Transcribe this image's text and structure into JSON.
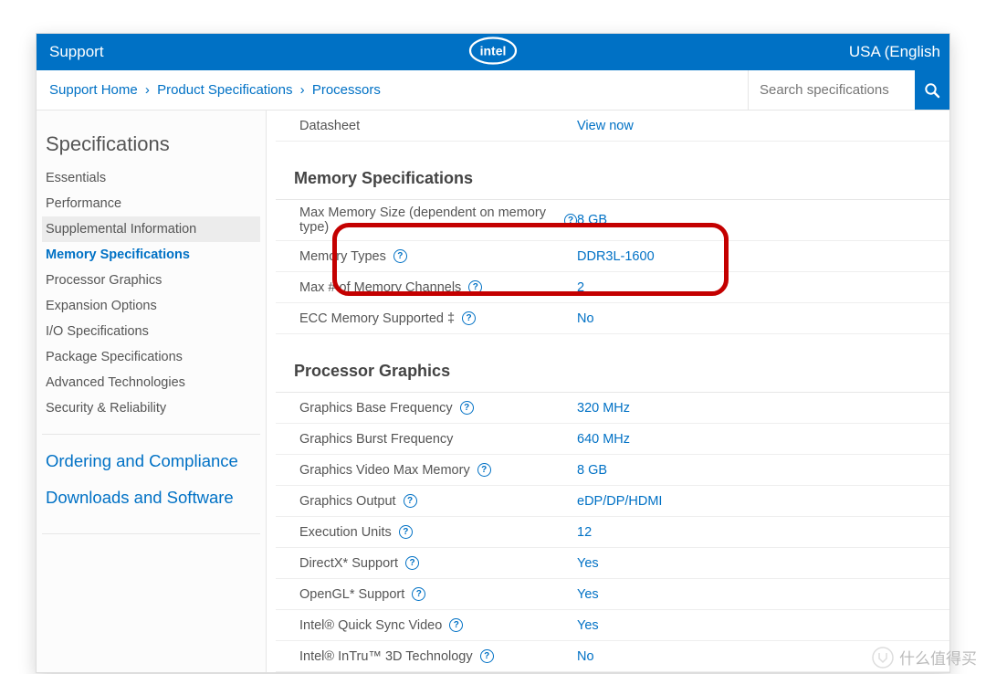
{
  "topbar": {
    "support": "Support",
    "region": "USA (English"
  },
  "breadcrumbs": {
    "a": "Support Home",
    "b": "Product Specifications",
    "c": "Processors",
    "sep": "›"
  },
  "search": {
    "placeholder": "Search specifications"
  },
  "sidebar": {
    "title": "Specifications",
    "items": [
      "Essentials",
      "Performance",
      "Supplemental Information",
      "Memory Specifications",
      "Processor Graphics",
      "Expansion Options",
      "I/O Specifications",
      "Package Specifications",
      "Advanced Technologies",
      "Security & Reliability"
    ],
    "big1": "Ordering and Compliance",
    "big2": "Downloads and Software"
  },
  "prelude": {
    "label": "Datasheet",
    "value": "View now"
  },
  "sections": [
    {
      "title": "Memory Specifications",
      "rows": [
        {
          "label": "Max Memory Size (dependent on memory type)",
          "help": true,
          "value": "8 GB"
        },
        {
          "label": "Memory Types",
          "help": true,
          "value": "DDR3L-1600"
        },
        {
          "label": "Max # of Memory Channels",
          "help": true,
          "value": "2"
        },
        {
          "label": "ECC Memory Supported ‡",
          "help": true,
          "value": "No"
        }
      ]
    },
    {
      "title": "Processor Graphics",
      "rows": [
        {
          "label": "Graphics Base Frequency",
          "help": true,
          "value": "320 MHz"
        },
        {
          "label": "Graphics Burst Frequency",
          "help": false,
          "value": "640 MHz"
        },
        {
          "label": "Graphics Video Max Memory",
          "help": true,
          "value": "8 GB"
        },
        {
          "label": "Graphics Output",
          "help": true,
          "value": "eDP/DP/HDMI"
        },
        {
          "label": "Execution Units",
          "help": true,
          "value": "12"
        },
        {
          "label": "DirectX* Support",
          "help": true,
          "value": "Yes"
        },
        {
          "label": "OpenGL* Support",
          "help": true,
          "value": "Yes"
        },
        {
          "label": "Intel® Quick Sync Video",
          "help": true,
          "value": "Yes"
        },
        {
          "label": "Intel® InTru™ 3D Technology",
          "help": true,
          "value": "No"
        }
      ]
    }
  ],
  "watermark": "什么值得买"
}
